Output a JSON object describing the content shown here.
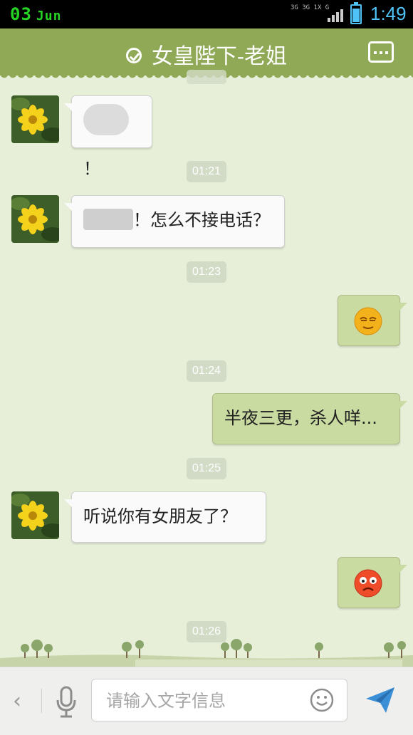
{
  "status_bar": {
    "day": "03",
    "month": "Jun",
    "network": "3G",
    "network2": "3G 1X",
    "network3": "G",
    "time": "1:49"
  },
  "header": {
    "title": "女皇陛下-老姐",
    "verified_icon": "check-circle-icon",
    "menu_icon": "more-dots-icon"
  },
  "messages": [
    {
      "from": "them",
      "text": "！",
      "blurred_prefix": true
    },
    {
      "type": "time",
      "text": "01:21"
    },
    {
      "from": "them",
      "text": "！怎么不接电话？",
      "blurred_prefix": true
    },
    {
      "type": "time",
      "text": "01:23"
    },
    {
      "from": "me",
      "emoji": "smirk-face-emoji"
    },
    {
      "type": "time",
      "text": "01:24"
    },
    {
      "from": "me",
      "text": "半夜三更，杀人咩..."
    },
    {
      "type": "time",
      "text": "01:25"
    },
    {
      "from": "them",
      "text": "听说你有女朋友了？"
    },
    {
      "from": "me",
      "emoji": "angry-face-emoji"
    },
    {
      "type": "time",
      "text": "01:26"
    }
  ],
  "input_bar": {
    "placeholder": "请输入文字信息",
    "back_glyph": "‹"
  },
  "colors": {
    "header": "#8fa956",
    "background": "#e7efd9",
    "outgoing_bubble": "#c9dba0",
    "incoming_bubble": "#fafafa",
    "status_time": "#4fc3f7",
    "status_date": "#25d325"
  }
}
